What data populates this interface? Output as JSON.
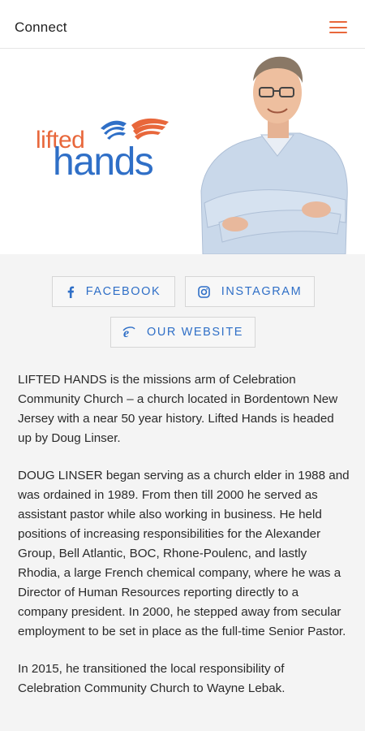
{
  "header": {
    "title": "Connect",
    "menu_icon": "hamburger-menu-icon",
    "accent_color": "#e8673b"
  },
  "hero": {
    "logo": {
      "word1": "lifted",
      "word2": "hands",
      "word1_color": "#e8673b",
      "word2_color": "#2f6fc7"
    },
    "photo_description_icon": "portrait-photo"
  },
  "buttons": {
    "facebook": {
      "label": "FACEBOOK",
      "icon": "facebook-icon"
    },
    "instagram": {
      "label": "INSTAGRAM",
      "icon": "instagram-icon"
    },
    "website": {
      "label": "OUR WEBSITE",
      "icon": "web-browser-icon"
    },
    "link_color": "#2f6fc7"
  },
  "content": {
    "paragraphs": [
      "LIFTED HANDS is the missions arm of Celebration Community Church – a church located in Bordentown New Jersey with a near 50 year history. Lifted Hands is headed up by Doug Linser.",
      "DOUG LINSER began serving as a church elder in 1988 and was ordained in 1989. From then till 2000 he served as assistant pastor while also working in business. He held positions of increasing responsibilities for the Alexander Group, Bell Atlantic, BOC, Rhone-Poulenc, and lastly Rhodia, a large French chemical company, where he was a Director of Human Resources reporting directly to a company president. In 2000, he stepped away from secular employment to be set in place as the full-time Senior Pastor.",
      "In 2015, he transitioned the local responsibility of Celebration Community Church to Wayne Lebak."
    ]
  }
}
